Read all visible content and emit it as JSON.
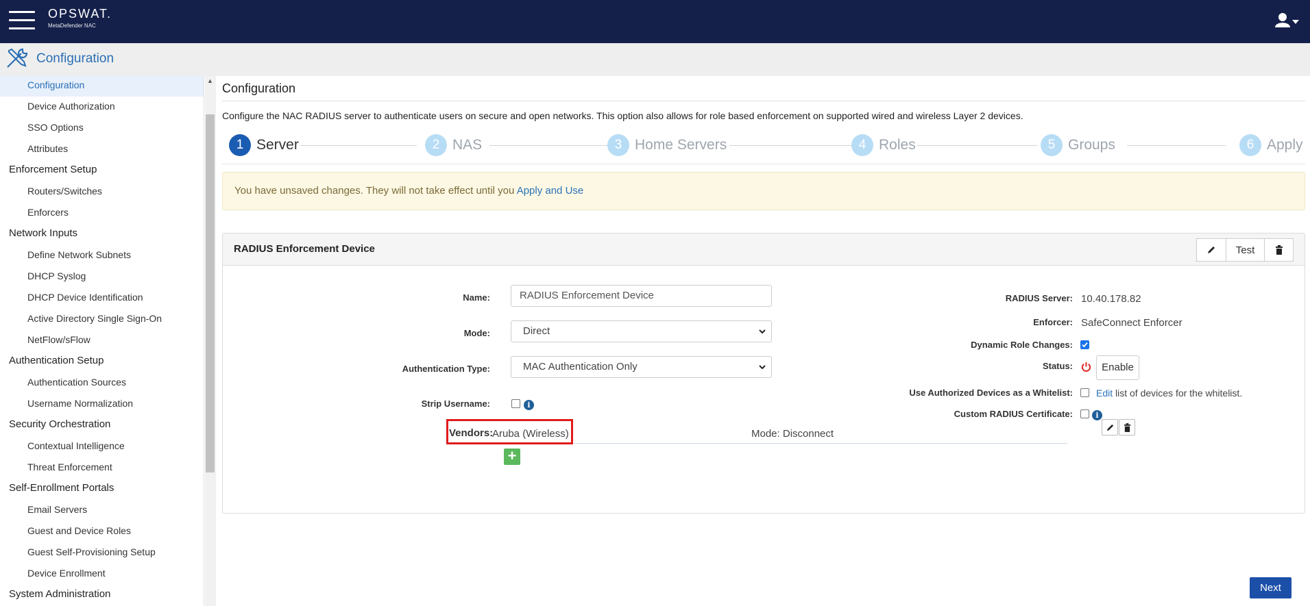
{
  "app": {
    "brand": "OPSWAT.",
    "product": "MetaDefender NAC"
  },
  "header": {
    "title": "Configuration"
  },
  "sidebar": {
    "items": [
      {
        "label": "Configuration",
        "type": "sub",
        "active": true
      },
      {
        "label": "Device Authorization",
        "type": "sub"
      },
      {
        "label": "SSO Options",
        "type": "sub"
      },
      {
        "label": "Attributes",
        "type": "sub"
      },
      {
        "label": "Enforcement Setup",
        "type": "section"
      },
      {
        "label": "Routers/Switches",
        "type": "sub"
      },
      {
        "label": "Enforcers",
        "type": "sub"
      },
      {
        "label": "Network Inputs",
        "type": "section"
      },
      {
        "label": "Define Network Subnets",
        "type": "sub"
      },
      {
        "label": "DHCP Syslog",
        "type": "sub"
      },
      {
        "label": "DHCP Device Identification",
        "type": "sub"
      },
      {
        "label": "Active Directory Single Sign-On",
        "type": "sub"
      },
      {
        "label": "NetFlow/sFlow",
        "type": "sub"
      },
      {
        "label": "Authentication Setup",
        "type": "section"
      },
      {
        "label": "Authentication Sources",
        "type": "sub"
      },
      {
        "label": "Username Normalization",
        "type": "sub"
      },
      {
        "label": "Security Orchestration",
        "type": "section"
      },
      {
        "label": "Contextual Intelligence",
        "type": "sub"
      },
      {
        "label": "Threat Enforcement",
        "type": "sub"
      },
      {
        "label": "Self-Enrollment Portals",
        "type": "section"
      },
      {
        "label": "Email Servers",
        "type": "sub"
      },
      {
        "label": "Guest and Device Roles",
        "type": "sub"
      },
      {
        "label": "Guest Self-Provisioning Setup",
        "type": "sub"
      },
      {
        "label": "Device Enrollment",
        "type": "sub"
      },
      {
        "label": "System Administration",
        "type": "section"
      }
    ]
  },
  "main": {
    "title": "Configuration",
    "description": "Configure the NAC RADIUS server to authenticate users on secure and open networks. This option also allows for role based enforcement on supported wired and wireless Layer 2 devices.",
    "steps": [
      {
        "num": "1",
        "label": "Server",
        "active": true
      },
      {
        "num": "2",
        "label": "NAS"
      },
      {
        "num": "3",
        "label": "Home Servers"
      },
      {
        "num": "4",
        "label": "Roles"
      },
      {
        "num": "5",
        "label": "Groups"
      },
      {
        "num": "6",
        "label": "Apply"
      }
    ],
    "alert": {
      "text": "You have unsaved changes. They will not take effect until you ",
      "link": "Apply and Use"
    },
    "panel": {
      "title": "RADIUS Enforcement Device",
      "test_label": "Test",
      "name_label": "Name:",
      "name_value": "RADIUS Enforcement Device",
      "mode_label": "Mode:",
      "mode_value": "Direct",
      "auth_type_label": "Authentication Type:",
      "auth_type_value": "MAC Authentication Only",
      "strip_username_label": "Strip Username:",
      "radius_server_label": "RADIUS Server:",
      "radius_server_value": "10.40.178.82",
      "enforcer_label": "Enforcer:",
      "enforcer_value": "SafeConnect Enforcer",
      "dynamic_role_label": "Dynamic Role Changes:",
      "dynamic_role_checked": true,
      "status_label": "Status:",
      "enable_label": "Enable",
      "whitelist_label": "Use Authorized Devices as a Whitelist:",
      "whitelist_link": "Edit",
      "whitelist_text": " list of devices for the whitelist.",
      "custom_cert_label": "Custom RADIUS Certificate:",
      "vendors_label": "Vendors:",
      "vendors_value": "Aruba (Wireless)",
      "vendor_mode": "Mode: Disconnect"
    },
    "next_label": "Next"
  },
  "colors": {
    "topbar": "#14204a",
    "accent": "#2b6fb5",
    "step_active": "#1b5cb3",
    "step_inactive": "#b7dcf5",
    "alert_bg": "#fcf8e3",
    "highlight": "#e01b1b",
    "add": "#5cb85c"
  }
}
